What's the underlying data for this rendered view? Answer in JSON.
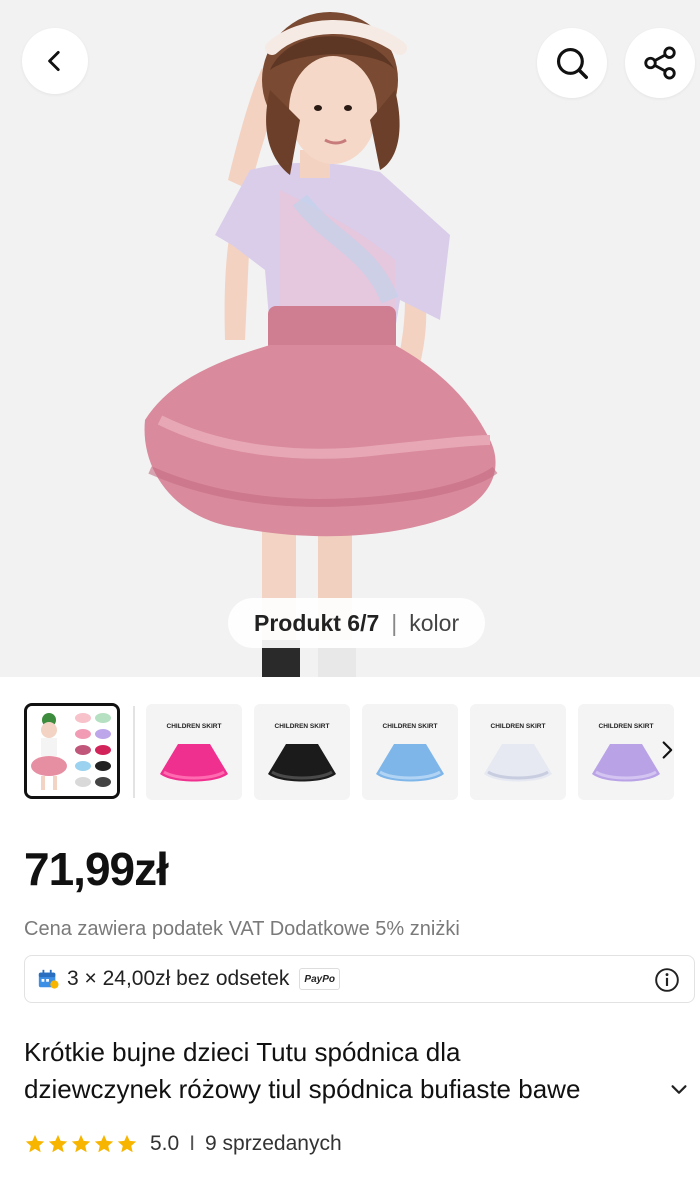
{
  "gallery": {
    "counter_position": "Produkt 6/7",
    "counter_separator": "|",
    "counter_label": "kolor",
    "thumbnails": [
      {
        "name": "collage",
        "color": "#e78fa2"
      },
      {
        "name": "pink",
        "color": "#f0308f"
      },
      {
        "name": "black",
        "color": "#1b1b1b"
      },
      {
        "name": "blue",
        "color": "#7fb6ea"
      },
      {
        "name": "white",
        "color": "#eef0f5"
      },
      {
        "name": "lavender",
        "color": "#b9a3e6"
      }
    ],
    "thumbnail_brand": "CHILDREN SKIRT"
  },
  "product": {
    "price": "71,99zł",
    "price_note": "Cena zawiera podatek VAT Dodatkowe 5% zniżki",
    "installment_text": "3 × 24,00zł bez odsetek",
    "installment_provider": "PayPo",
    "title_line1": "Krótkie bujne dzieci Tutu spódnica dla",
    "title_line2": "dziewczynek różowy tiul spódnica bufiaste bawe",
    "rating_value": "5.0",
    "rating_separator": "I",
    "sold_count": "9 sprzedanych",
    "stars": 5
  },
  "icons": {
    "back": "chevron-left-icon",
    "search": "search-icon",
    "share": "share-icon",
    "next": "chevron-right-icon",
    "info": "info-icon",
    "expand": "chevron-down-icon",
    "calendar": "calendar-icon",
    "star": "star-icon"
  },
  "colors": {
    "star": "#f7b500",
    "skirt": "#d98a9c",
    "price": "#111111"
  }
}
